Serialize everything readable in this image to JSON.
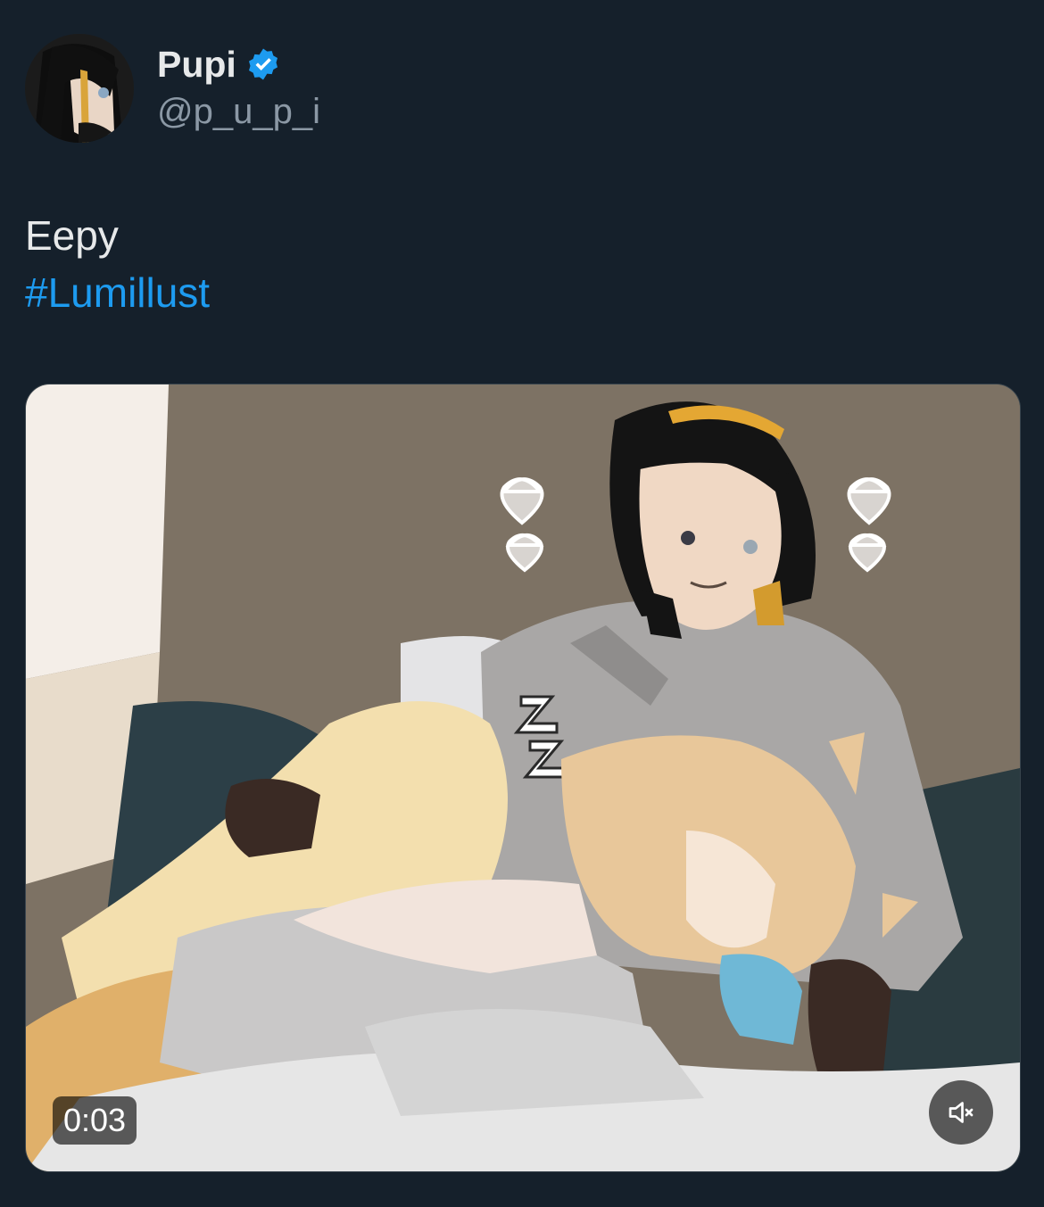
{
  "author": {
    "display_name": "Pupi",
    "handle": "@p_u_p_i",
    "verified": true,
    "avatar_icon": "profile-avatar",
    "verified_icon": "verified-badge-icon"
  },
  "tweet": {
    "text": "Eepy",
    "hashtag": "#Lumillust"
  },
  "media": {
    "type": "video",
    "duration": "0:03",
    "mute_icon": "speaker-muted-icon"
  },
  "colors": {
    "background": "#15202b",
    "link": "#1d9bf0",
    "secondary_text": "#8b98a5",
    "verified": "#1d9bf0"
  }
}
